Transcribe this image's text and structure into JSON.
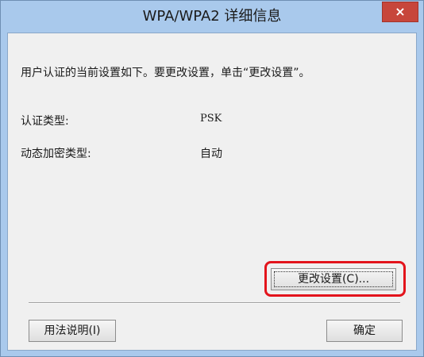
{
  "window": {
    "title": "WPA/WPA2 详细信息",
    "close_label": "×"
  },
  "content": {
    "instruction": "用户认证的当前设置如下。要更改设置，单击“更改设置”。",
    "auth_type_label": "认证类型:",
    "auth_type_value": "PSK",
    "encryption_label": "动态加密类型:",
    "encryption_value": "自动"
  },
  "buttons": {
    "change_settings": "更改设置(C)...",
    "help": "用法说明(I)",
    "ok": "确定"
  },
  "colors": {
    "titlebar": "#a9c9ec",
    "close_button": "#c7463b",
    "highlight": "#e3141c",
    "client_bg": "#f0f0f0"
  }
}
